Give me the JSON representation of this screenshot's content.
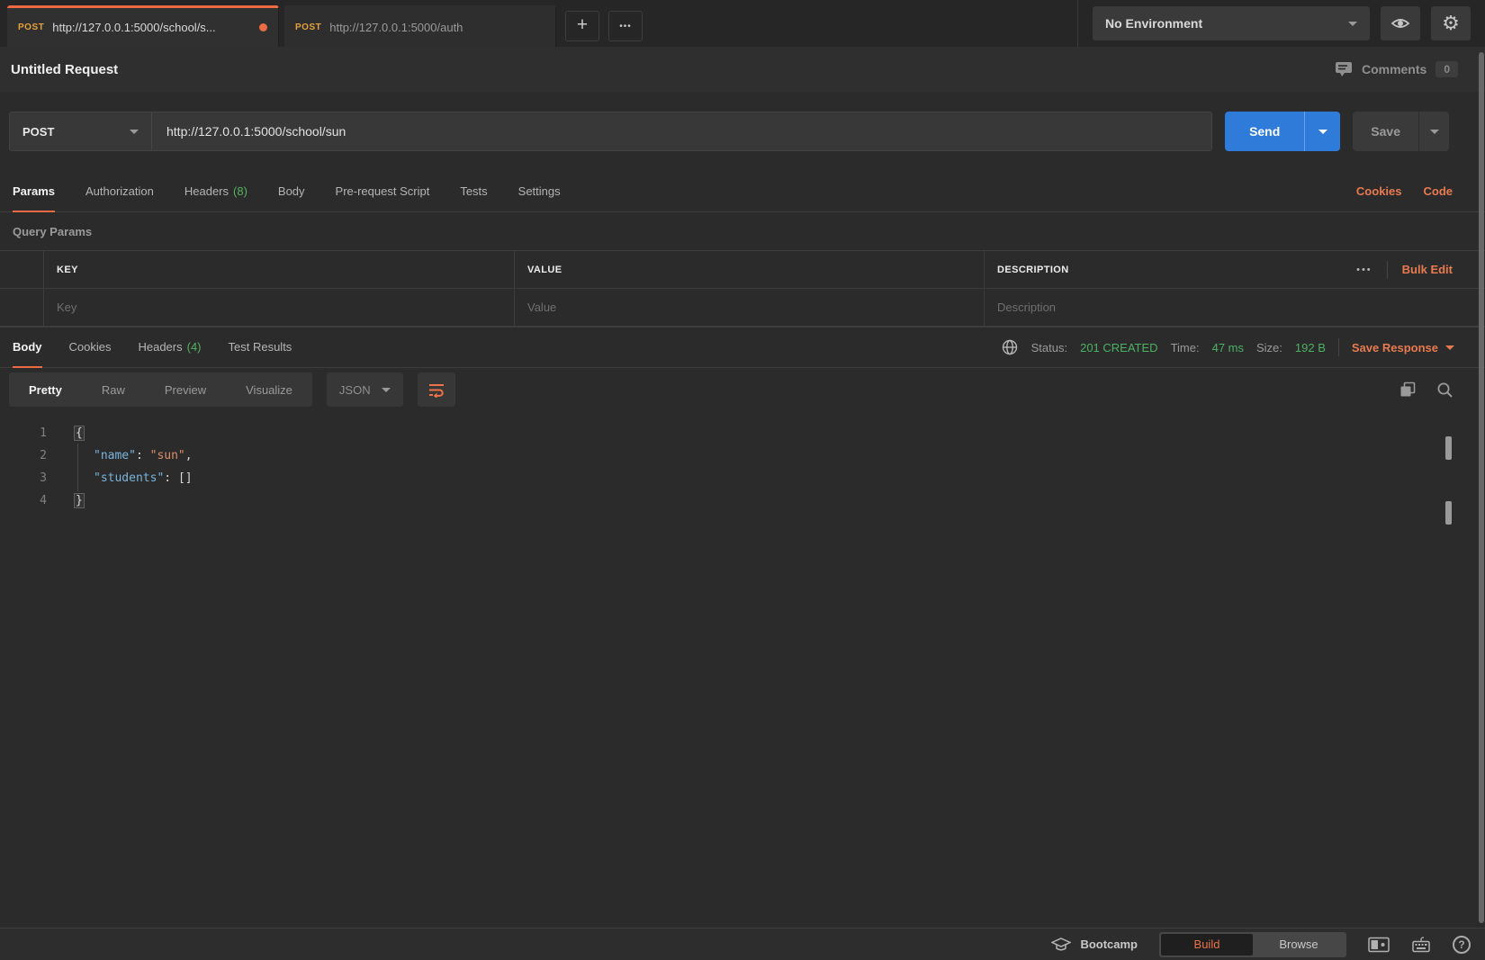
{
  "colors": {
    "accent_orange": "#EC6B42",
    "link_orange": "#E87A50",
    "send_blue": "#2F7BD9",
    "status_green": "#4CB163",
    "post_method_yellow": "#E7A13C",
    "json_key_blue": "#7AB4DC",
    "json_string_orange": "#DF8E6B"
  },
  "icons": {
    "plus_glyph": "+",
    "more_glyph": "•••",
    "gear_glyph": "⚙",
    "help_glyph": "?"
  },
  "topbar": {
    "tabs": [
      {
        "method": "POST",
        "url": "http://127.0.0.1:5000/school/s..."
      },
      {
        "method": "POST",
        "url": "http://127.0.0.1:5000/auth"
      }
    ],
    "environment": {
      "selected": "No Environment"
    }
  },
  "request_header": {
    "title": "Untitled Request",
    "comments_label": "Comments",
    "comments_count": "0"
  },
  "builder": {
    "method": "POST",
    "url": "http://127.0.0.1:5000/school/sun",
    "send_label": "Send",
    "save_label": "Save"
  },
  "request_tabs": {
    "params": "Params",
    "authorization": "Authorization",
    "headers": "Headers",
    "headers_count": "(8)",
    "body": "Body",
    "pre_request_script": "Pre-request Script",
    "tests": "Tests",
    "settings": "Settings",
    "cookies_link": "Cookies",
    "code_link": "Code"
  },
  "query_params": {
    "title": "Query Params",
    "columns": {
      "key": "KEY",
      "value": "VALUE",
      "description": "DESCRIPTION"
    },
    "placeholders": {
      "key": "Key",
      "value": "Value",
      "description": "Description"
    },
    "more_glyph": "•••",
    "bulk_edit_label": "Bulk Edit"
  },
  "response": {
    "tabs": {
      "body": "Body",
      "cookies": "Cookies",
      "headers": "Headers",
      "headers_count": "(4)",
      "test_results": "Test Results"
    },
    "meta": {
      "status_label": "Status:",
      "status_value": "201 CREATED",
      "time_label": "Time:",
      "time_value": "47 ms",
      "size_label": "Size:",
      "size_value": "192 B",
      "save_response_label": "Save Response"
    },
    "viewer": {
      "pretty": "Pretty",
      "raw": "Raw",
      "preview": "Preview",
      "visualize": "Visualize",
      "format": "JSON"
    },
    "code": {
      "line_numbers": [
        "1",
        "2",
        "3",
        "4"
      ],
      "l1_open": "{",
      "l2_key": "\"name\"",
      "l2_colon": ": ",
      "l2_value": "\"sun\"",
      "l2_comma": ",",
      "l3_key": "\"students\"",
      "l3_colon": ": ",
      "l3_value": "[]",
      "l4_close": "}"
    }
  },
  "bottombar": {
    "bootcamp_label": "Bootcamp",
    "build_label": "Build",
    "browse_label": "Browse"
  }
}
